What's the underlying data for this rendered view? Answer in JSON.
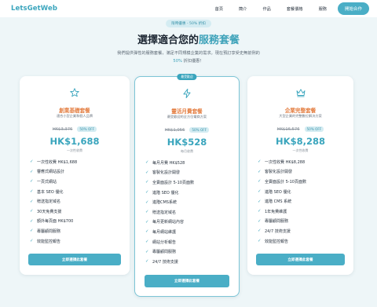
{
  "nav": {
    "logo": "LetsGetWeb",
    "links": [
      "首頁",
      "簡介",
      "作品",
      "套餐價格",
      "服務"
    ],
    "cta": "開始合作"
  },
  "hero": {
    "badge": "限時優惠 - 50% 折扣",
    "title_prefix": "選擇適合您的",
    "title_highlight": "服務套餐",
    "desc_line1": "我們提供彈性的服務套餐，滿足不同規模企業的需求。現在預訂享受史無前例的",
    "desc_highlight": "50%",
    "desc_suffix": "折扣優惠！"
  },
  "plans": [
    {
      "icon": "star-icon",
      "name": "創業基礎套餐",
      "subtitle": "適合小型企業和個人品牌",
      "original_price": "HK$3,376",
      "discount": "50% OFF",
      "price": "HK$1,688",
      "price_note": "一次性收費",
      "features": [
        "一次性收費 HK$1,688",
        "響應式網站設計",
        "一頁式網站",
        "基本 SEO 優化",
        "贈送指定域名",
        "30天免費支援",
        "額外每頁面 HK$700",
        "專屬顧問服務",
        "效能監控報告"
      ],
      "button": "立即選擇此套餐"
    },
    {
      "icon": "lightning-icon",
      "badge": "最受歡迎",
      "name": "靈活月費套餐",
      "subtitle": "最受歡迎的全方位電商方案",
      "original_price": "HK$1,056",
      "discount": "50% OFF",
      "price": "HK$528",
      "price_note": "每月收費",
      "features": [
        "每月月費 HK$528",
        "客製化設計開發",
        "全賣面設計 5-10頁面數",
        "進階 SEO 優化",
        "進階CMS系統",
        "贈送指定域名",
        "每月更新網站內容",
        "每月網站維護",
        "網站分析報告",
        "專屬顧問服務",
        "24/7 技術支援"
      ],
      "button": "立即選擇此套餐"
    },
    {
      "icon": "crown-icon",
      "name": "企業完整套餐",
      "subtitle": "大型企業的完整數位解決方案",
      "original_price": "HK$16,576",
      "discount": "50% OFF",
      "price": "HK$8,288",
      "price_note": "一次性收費",
      "features": [
        "一次性收費 HK$8,288",
        "客製化設計開發",
        "全賣面設計 5-10頁面數",
        "進階 SEO 優化",
        "進階 CMS 系統",
        "1年免費維護",
        "專屬顧問服務",
        "24/7 技術支援",
        "效能監控報告"
      ],
      "button": "立即選擇此套餐"
    }
  ],
  "colors": {
    "accent": "#3aa5bd",
    "plan_name": "#e37c3f",
    "background": "#eef6f8"
  }
}
